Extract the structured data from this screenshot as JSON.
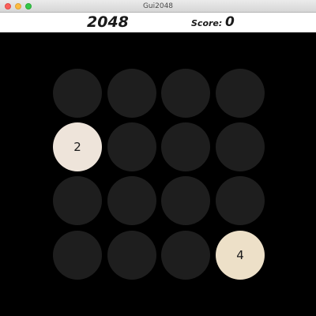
{
  "window": {
    "title": "Gui2048"
  },
  "header": {
    "game_title": "2048",
    "score_label": "Score:",
    "score_value": "0"
  },
  "colors": {
    "empty_cell": "#1e1e1e",
    "tile_2": "#eee4da",
    "tile_4": "#ede0c8",
    "board_background": "#000000"
  },
  "board": {
    "rows": [
      [
        "",
        "",
        "",
        ""
      ],
      [
        "2",
        "",
        "",
        ""
      ],
      [
        "",
        "",
        "",
        ""
      ],
      [
        "",
        "",
        "",
        "4"
      ]
    ]
  }
}
